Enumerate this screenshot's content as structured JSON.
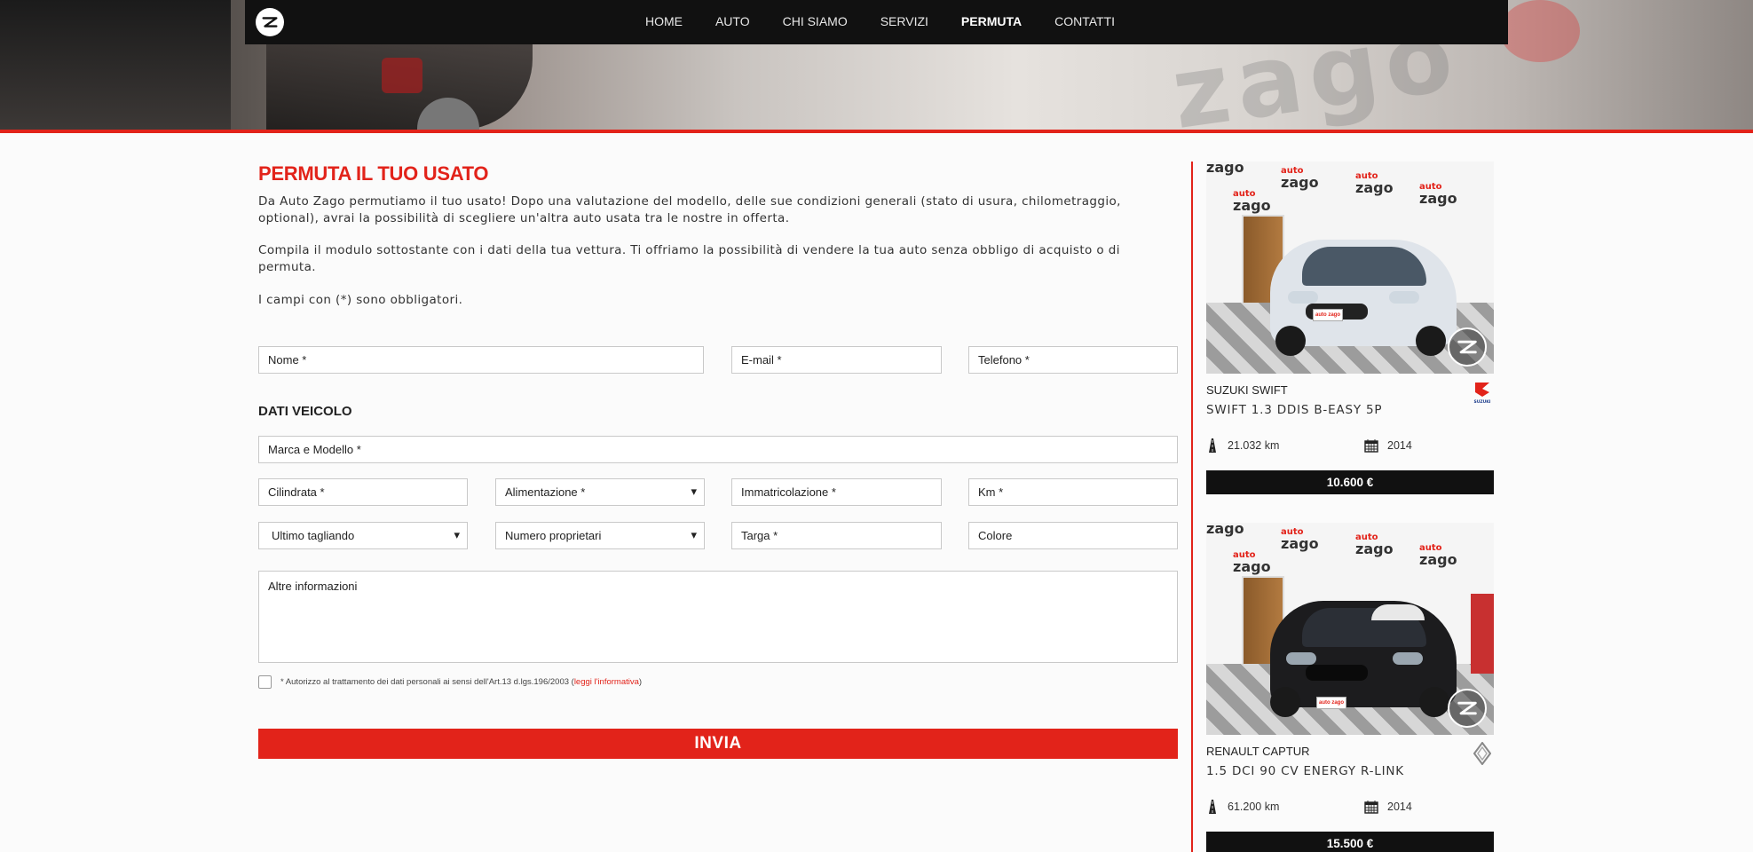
{
  "nav": {
    "items": [
      {
        "label": "HOME"
      },
      {
        "label": "AUTO"
      },
      {
        "label": "CHI SIAMO"
      },
      {
        "label": "SERVIZI"
      },
      {
        "label": "PERMUTA",
        "active": true
      },
      {
        "label": "CONTATTI"
      }
    ],
    "logo_icon": "auto-zago-logo-icon"
  },
  "hero": {
    "background_text": "zago"
  },
  "page": {
    "title": "PERMUTA IL TUO USATO",
    "intro_1": "Da Auto Zago permutiamo il tuo usato! Dopo una valutazione del modello, delle sue condizioni generali (stato di usura, chilometraggio, optional), avrai la possibilità di scegliere un'altra auto usata tra le nostre in offerta.",
    "intro_2": "Compila il modulo sottostante con i dati della tua vettura. Ti offriamo la possibilità di vendere la tua auto senza obbligo di acquisto o di permuta.",
    "intro_3": "I campi con (*) sono obbligatori."
  },
  "form": {
    "nome": "Nome *",
    "email": "E-mail *",
    "telefono": "Telefono *",
    "section_vehicle": "DATI VEICOLO",
    "marca_modello": "Marca e Modello *",
    "cilindrata": "Cilindrata *",
    "alimentazione": "Alimentazione *",
    "immatricolazione": "Immatricolazione *",
    "km": "Km *",
    "ultimo_tagliando": "Ultimo tagliando",
    "numero_proprietari": "Numero proprietari",
    "targa": "Targa *",
    "colore": "Colore",
    "altre_info": "Altre informazioni",
    "consent_text": "* Autorizzo al trattamento dei dati personali ai sensi dell'Art.13 d.lgs.196/2003 (",
    "consent_link": "leggi l'informativa",
    "consent_close": ")",
    "submit": "INVIA"
  },
  "cars": [
    {
      "brand": "SUZUKI SWIFT",
      "model": "SWIFT 1.3 DDIS B-EASY 5P",
      "km": "21.032 km",
      "year": "2014",
      "price": "10.600 €",
      "brand_icon": "suzuki-logo-icon",
      "plate_text": "auto zago",
      "color": "#dfe4ea"
    },
    {
      "brand": "RENAULT CAPTUR",
      "model": "1.5 DCI 90 CV ENERGY R-LINK",
      "km": "61.200 km",
      "year": "2014",
      "price": "15.500 €",
      "brand_icon": "renault-logo-icon",
      "plate_text": "auto zago",
      "color": "#1c1c1e"
    }
  ],
  "watermark": {
    "auto": "auto",
    "zago": "zago"
  },
  "colors": {
    "accent": "#e2231a",
    "nav_bg": "#111111",
    "price_bg": "#111111"
  }
}
